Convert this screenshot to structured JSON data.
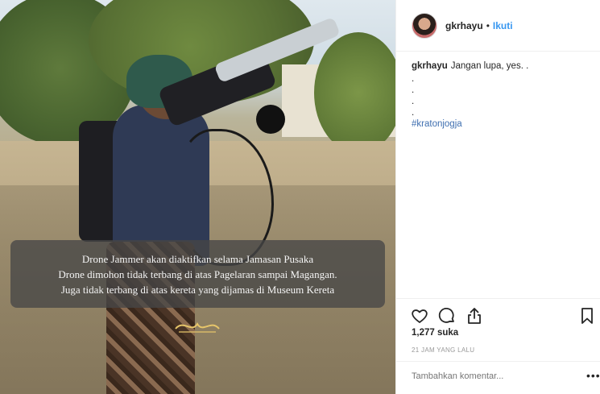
{
  "post": {
    "caption_overlay": [
      "Drone Jammer akan diaktifkan selama Jamasan Pusaka",
      "Drone dimohon tidak terbang di atas Pagelaran sampai Magangan.",
      "Juga tidak terbang di atas kereta yang dijamas di Museum Kereta"
    ]
  },
  "header": {
    "username": "gkrhayu",
    "separator": "•",
    "follow_label": "Ikuti"
  },
  "comment": {
    "username": "gkrhayu",
    "text": "Jangan lupa, yes. .",
    "dots": [
      ".",
      ".",
      ".",
      "."
    ],
    "hashtag": "#kratonjogja"
  },
  "actions": {
    "icons": [
      "heart-icon",
      "comment-icon",
      "share-icon",
      "bookmark-icon"
    ]
  },
  "likes": "1,277 suka",
  "timestamp": "21 JAM YANG LALU",
  "add_comment": {
    "placeholder": "Tambahkan komentar...",
    "more_label": "•••"
  },
  "colors": {
    "link": "#3897f0",
    "hashtag": "#3f6fb0",
    "muted": "#999999"
  }
}
